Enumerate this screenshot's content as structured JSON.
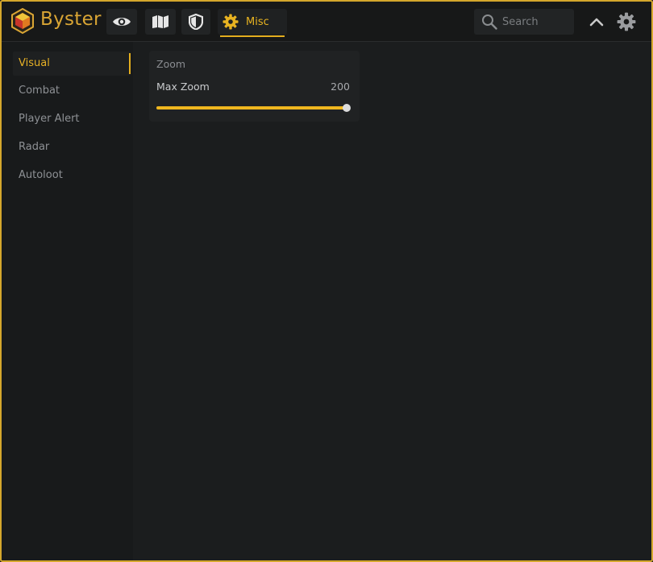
{
  "app": {
    "brand": "Byster",
    "accent_color": "#e3ae1f"
  },
  "header": {
    "tabs": [
      {
        "icon": "eye-icon",
        "label": ""
      },
      {
        "icon": "map-icon",
        "label": ""
      },
      {
        "icon": "shield-icon",
        "label": ""
      },
      {
        "icon": "gear-icon",
        "label": "Misc",
        "active": true
      }
    ],
    "search": {
      "placeholder": "Search",
      "value": ""
    },
    "collapse_icon": "chevron-up-icon",
    "settings_icon": "gear-icon"
  },
  "sidebar": {
    "items": [
      {
        "label": "Visual",
        "active": true
      },
      {
        "label": "Combat"
      },
      {
        "label": "Player Alert"
      },
      {
        "label": "Radar"
      },
      {
        "label": "Autoloot"
      }
    ]
  },
  "main": {
    "card": {
      "title": "Zoom",
      "slider": {
        "label": "Max Zoom",
        "value": "200",
        "fraction": 1.0
      }
    }
  }
}
